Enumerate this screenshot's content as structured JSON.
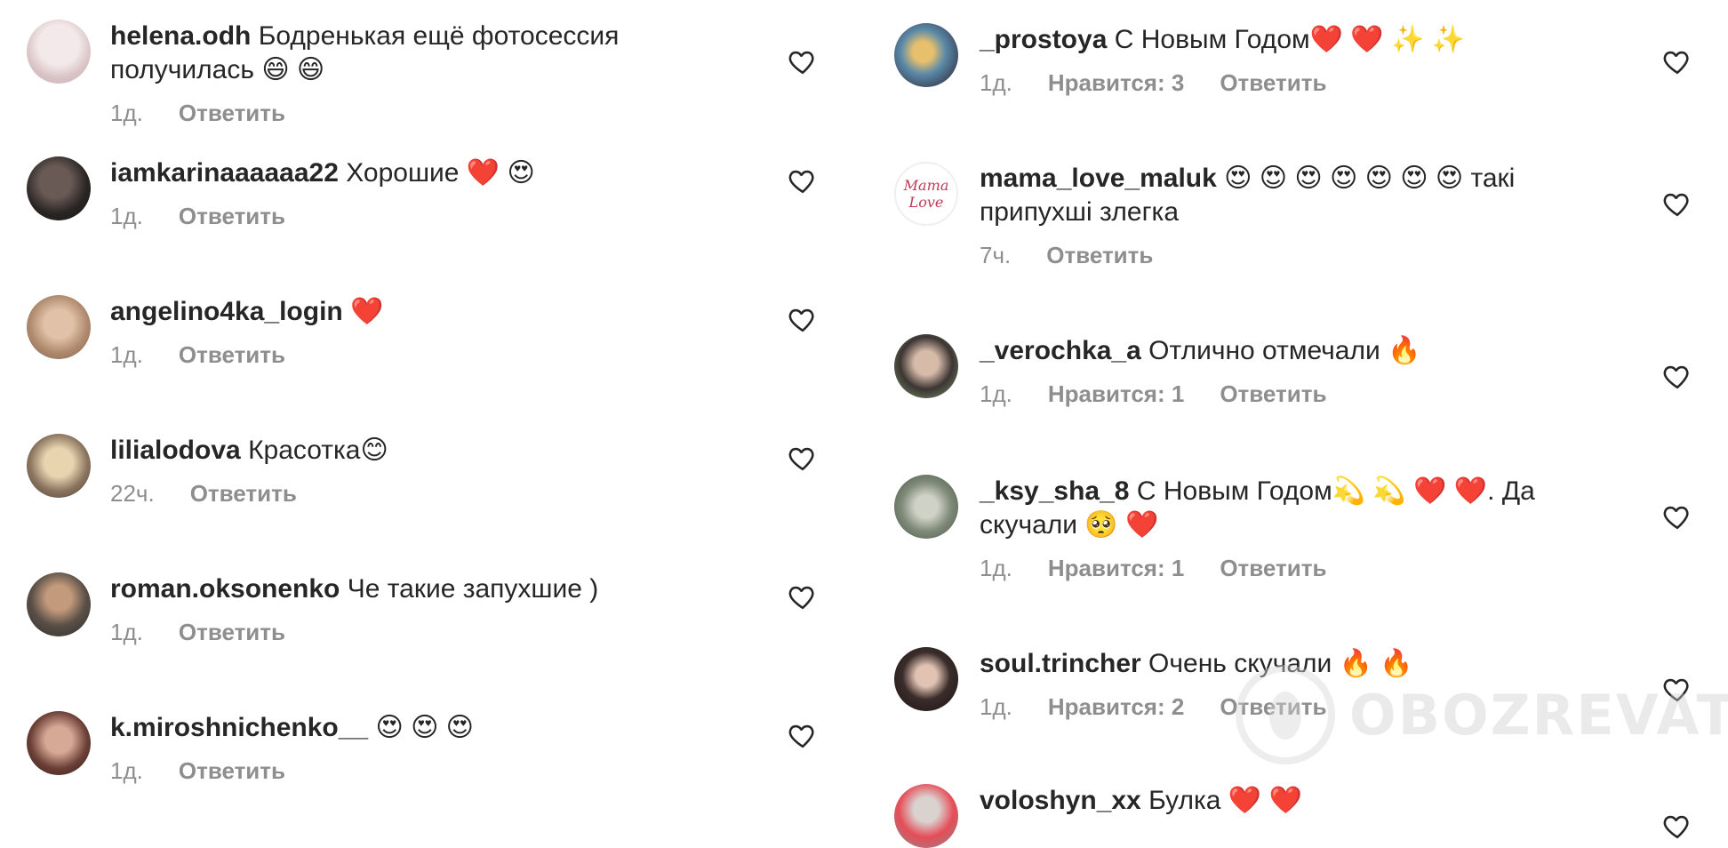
{
  "left_comments": [
    {
      "user": "helena.odh",
      "text": "Бодренькая ещё фотосессия получилась 😄 😄",
      "time": "1д.",
      "likes": "",
      "reply": "Ответить"
    },
    {
      "user": "iamkarinaaaaaa22",
      "text": "Хорошие ❤️ 😍",
      "time": "1д.",
      "likes": "",
      "reply": "Ответить"
    },
    {
      "user": "angelino4ka_login",
      "text": "❤️",
      "time": "1д.",
      "likes": "",
      "reply": "Ответить"
    },
    {
      "user": "lilialodova",
      "text": "Красотка😊",
      "time": "22ч.",
      "likes": "",
      "reply": "Ответить"
    },
    {
      "user": "roman.oksonenko",
      "text": "Че такие запухшие )",
      "time": "1д.",
      "likes": "",
      "reply": "Ответить"
    },
    {
      "user": "k.miroshnichenko__",
      "text": "😍 😍 😍",
      "time": "1д.",
      "likes": "",
      "reply": "Ответить"
    }
  ],
  "right_comments": [
    {
      "user": "_prostoya",
      "text": "С Новым Годом❤️ ❤️ ✨ ✨",
      "time": "1д.",
      "likes": "Нравится: 3",
      "reply": "Ответить"
    },
    {
      "user": "mama_love_maluk",
      "text": "😍 😍 😍 😍 😍 😍 😍 такі припухші злегка",
      "time": "7ч.",
      "likes": "",
      "reply": "Ответить"
    },
    {
      "user": "_verochka_a",
      "text": "Отлично отмечали 🔥",
      "time": "1д.",
      "likes": "Нравится: 1",
      "reply": "Ответить"
    },
    {
      "user": "_ksy_sha_8",
      "text": "С Новым Годом💫 💫 ❤️ ❤️. Да скучали 🥺 ❤️",
      "time": "1д.",
      "likes": "Нравится: 1",
      "reply": "Ответить"
    },
    {
      "user": "soul.trincher",
      "text": "Очень скучали 🔥 🔥",
      "time": "1д.",
      "likes": "Нравится: 2",
      "reply": "Ответить"
    },
    {
      "user": "voloshyn_xx",
      "text": "Булка ❤️ ❤️",
      "time": "",
      "likes": "",
      "reply": ""
    }
  ],
  "avatar_labels": {
    "mama": "Mama\nLove"
  },
  "watermark": {
    "text": "OBOZREVATEL"
  },
  "colors": {
    "text": "#262626",
    "meta": "#8e8e8e",
    "heart_outline": "#262626",
    "watermark": "#cfcfcf"
  }
}
